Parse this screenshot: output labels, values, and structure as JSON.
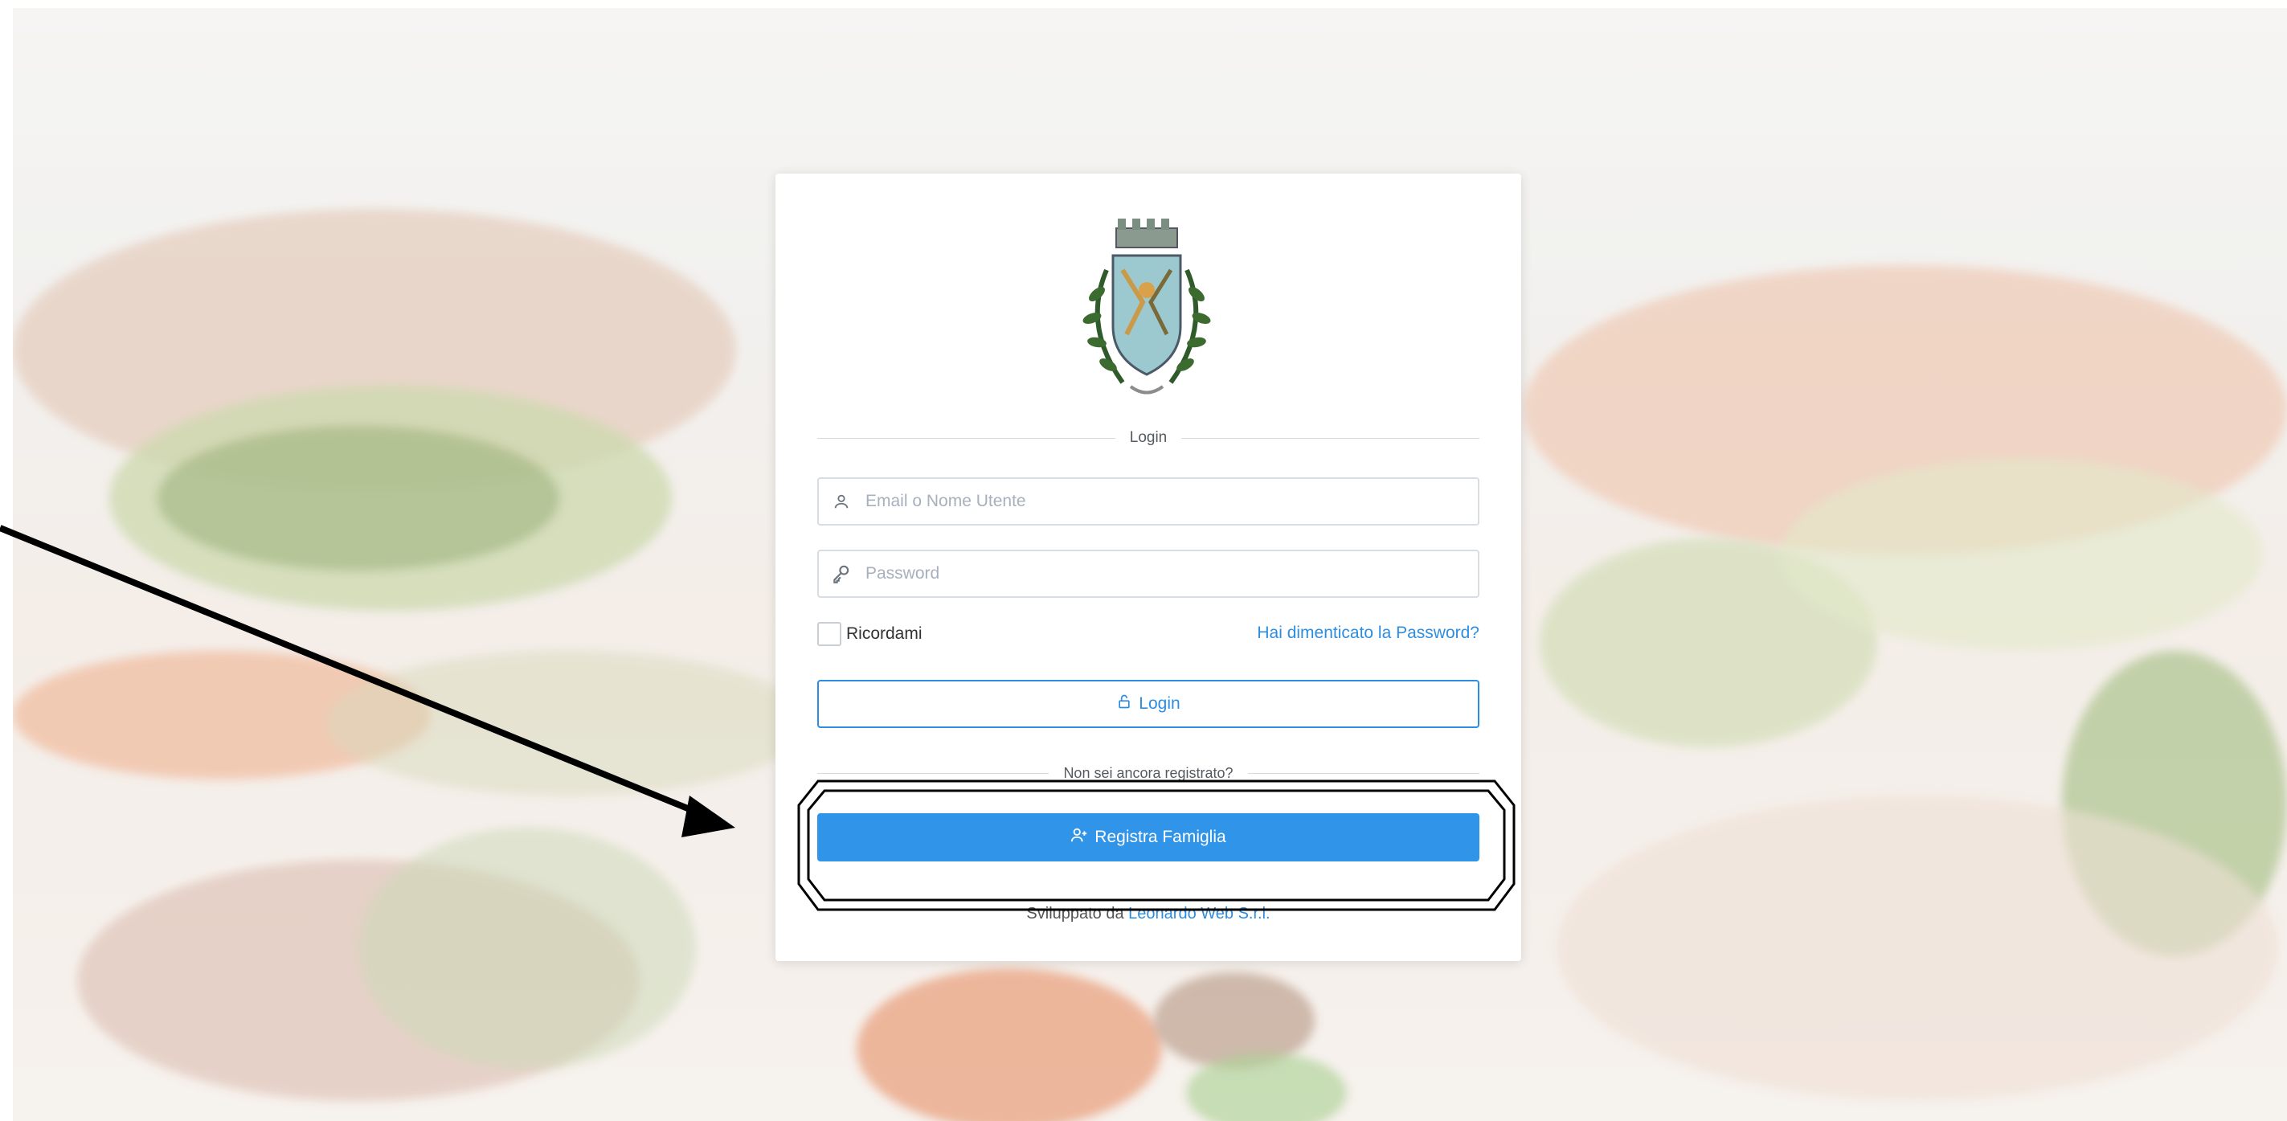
{
  "login_card": {
    "section_title": "Login",
    "username_placeholder": "Email o Nome Utente",
    "password_placeholder": "Password",
    "remember_label": "Ricordami",
    "forgot_link": "Hai dimenticato la Password?",
    "login_button": "Login",
    "register_prompt": "Non sei ancora registrato?",
    "register_button": "Registra Famiglia",
    "footer_prefix": "Sviluppato da",
    "footer_company": "Leonardo Web S.r.l."
  },
  "icons": {
    "username": "user-icon",
    "password": "key-icon",
    "login": "lock-icon",
    "register": "add-user-icon"
  },
  "colors": {
    "accent": "#3095e8",
    "link": "#2d8de0",
    "annotation": "#000000"
  }
}
